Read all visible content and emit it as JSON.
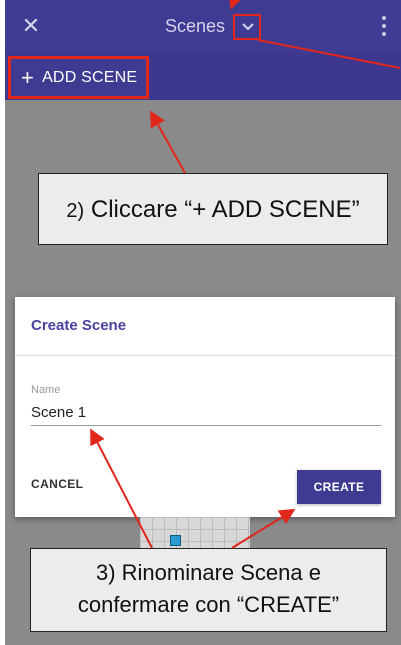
{
  "app_bar": {
    "title": "Scenes",
    "close_icon": "close-icon",
    "dropdown_icon": "chevron-down-icon",
    "menu_icon": "more-vert-icon"
  },
  "toolbar": {
    "add_scene_label": "ADD SCENE",
    "add_icon": "+"
  },
  "dialog": {
    "title": "Create Scene",
    "name_label": "Name",
    "name_value": "Scene 1",
    "cancel_label": "CANCEL",
    "create_label": "CREATE"
  },
  "callouts": {
    "step2_number": "2)",
    "step2_text": "Cliccare “+ ADD SCENE”",
    "step3_line1": "3) Rinominare Scena e",
    "step3_line2": "confermare con “CREATE”"
  },
  "colors": {
    "app_bar": "#3f3a92",
    "annotation_red": "#e1261c",
    "dialog_accent": "#4a43a0"
  }
}
